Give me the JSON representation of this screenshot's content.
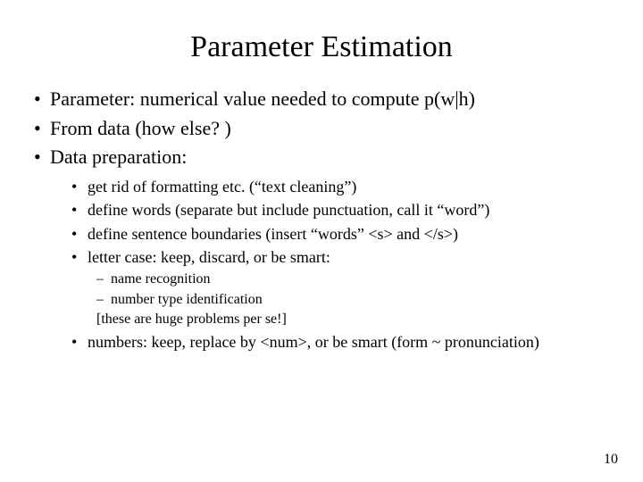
{
  "title": "Parameter Estimation",
  "bullets": {
    "b0": "Parameter: numerical value needed to compute p(w|h)",
    "b1": "From data (how else? )",
    "b2": "Data preparation:"
  },
  "sub": {
    "s0": "get rid of formatting etc. (“text cleaning”)",
    "s1": "define words (separate but include punctuation, call it “word”)",
    "s2": "define sentence boundaries (insert “words” <s> and </s>)",
    "s3": "letter case: keep, discard, or be smart:",
    "s4": "numbers: keep,  replace by <num>, or be smart (form ~ pronunciation)"
  },
  "subsub": {
    "d0": "name recognition",
    "d1": "number type identification",
    "note": "[these are huge problems per se!]"
  },
  "page_number": "10"
}
